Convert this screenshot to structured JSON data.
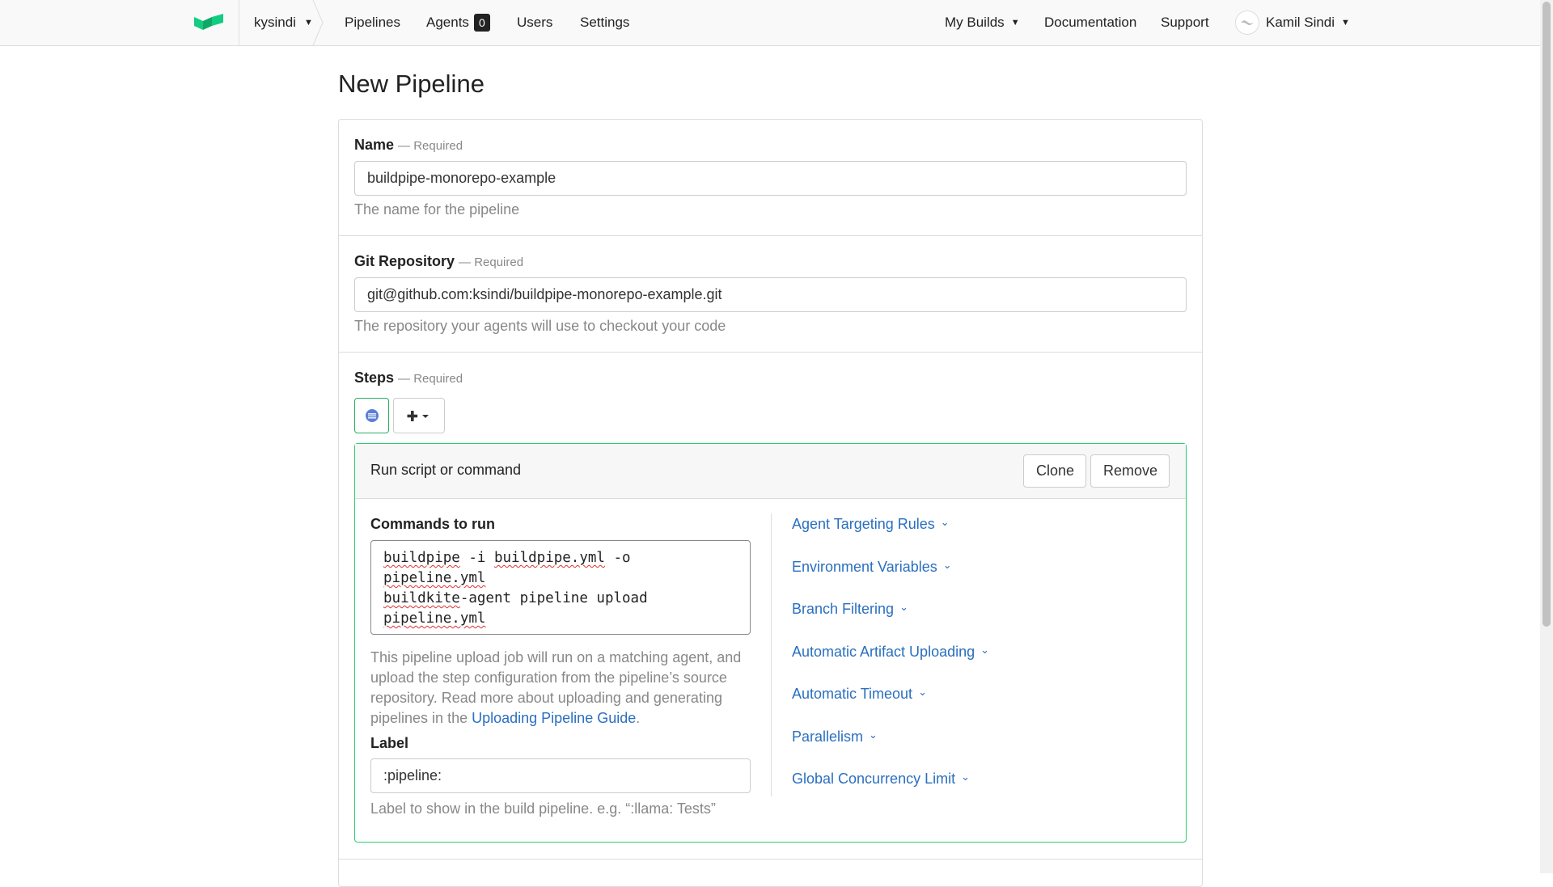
{
  "topbar": {
    "org": "kysindi",
    "nav": {
      "pipelines": "Pipelines",
      "agents": "Agents",
      "agents_count": "0",
      "users": "Users",
      "settings": "Settings"
    },
    "right": {
      "my_builds": "My Builds",
      "documentation": "Documentation",
      "support": "Support",
      "user_name": "Kamil Sindi"
    }
  },
  "page": {
    "title": "New Pipeline"
  },
  "form": {
    "required_tag": "— Required",
    "name": {
      "label": "Name",
      "value": "buildpipe-monorepo-example",
      "hint": "The name for the pipeline"
    },
    "repo": {
      "label": "Git Repository",
      "value": "git@github.com:ksindi/buildpipe-monorepo-example.git",
      "hint": "The repository your agents will use to checkout your code"
    },
    "steps": {
      "label": "Steps"
    }
  },
  "step": {
    "title": "Run script or command",
    "clone_label": "Clone",
    "remove_label": "Remove",
    "commands_label": "Commands to run",
    "cmd": {
      "l1a": "buildpipe",
      "l1b": " -i ",
      "l1c": "buildpipe.yml",
      "l1d": " -o",
      "l2": "pipeline.yml",
      "l3a": "buildkite",
      "l3b": "-agent pipeline upload",
      "l4": "pipeline.yml"
    },
    "description": "This pipeline upload job will run on a matching agent, and upload the step configuration from the pipeline’s source repository. Read more about uploading and generating pipelines in the ",
    "guide_link": "Uploading Pipeline Guide",
    "description_end": ".",
    "label_field": {
      "label": "Label",
      "value": ":pipeline:",
      "hint": "Label to show in the build pipeline. e.g. “:llama: Tests”"
    },
    "advanced": [
      "Agent Targeting Rules",
      "Environment Variables",
      "Branch Filtering",
      "Automatic Artifact Uploading",
      "Automatic Timeout",
      "Parallelism",
      "Global Concurrency Limit"
    ]
  },
  "colors": {
    "accent_link": "#2a6fbf",
    "step_border": "#2ecc71",
    "logo_green": "#14cc80"
  }
}
